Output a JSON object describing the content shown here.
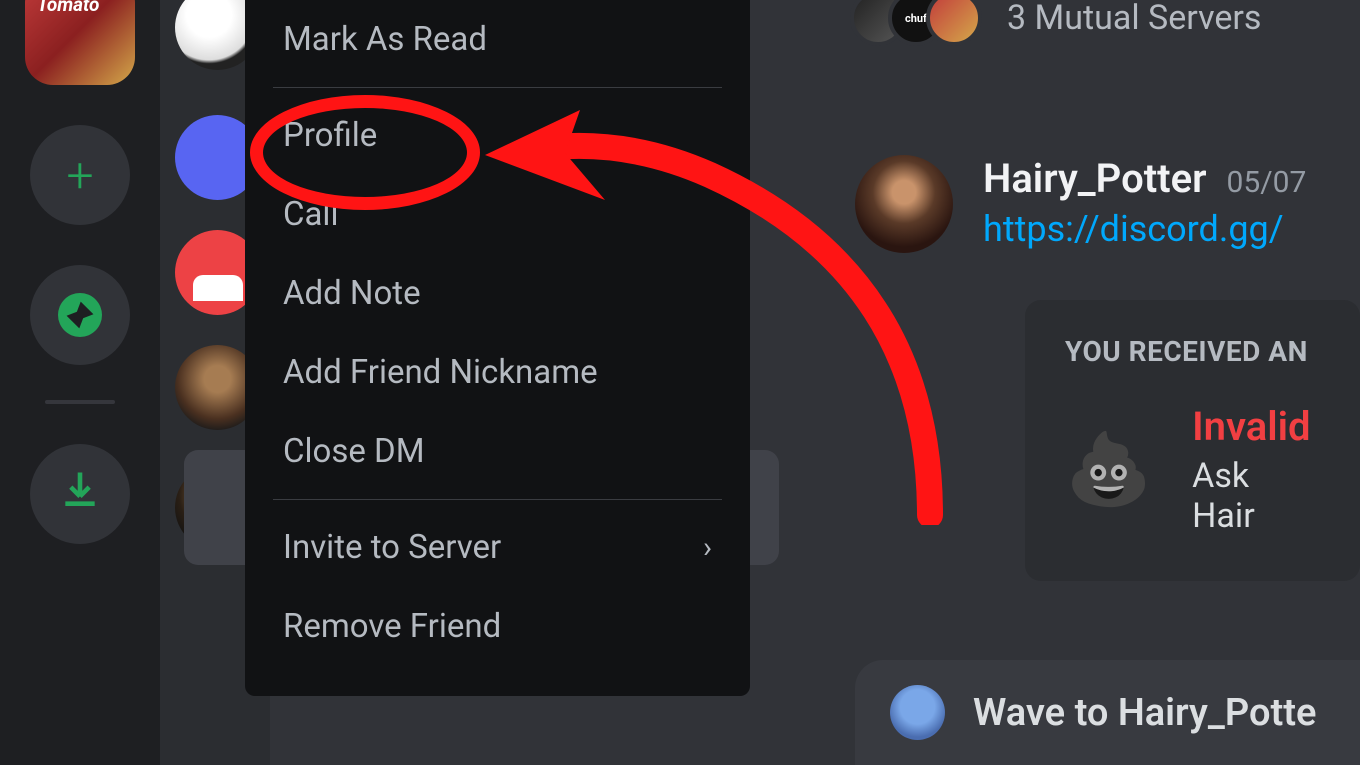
{
  "serverRail": {
    "topServerName": "Tomato"
  },
  "contextMenu": {
    "markAsRead": "Mark As Read",
    "profile": "Profile",
    "call": "Call",
    "addNote": "Add Note",
    "addFriendNickname": "Add Friend Nickname",
    "closeDm": "Close DM",
    "inviteToServer": "Invite to Server",
    "removeFriend": "Remove Friend"
  },
  "chat": {
    "mutualServersText": "3 Mutual Servers",
    "mutualBadge": "chuf",
    "message": {
      "username": "Hairy_Potter",
      "timestamp": "05/07",
      "link": "https://discord.gg/"
    },
    "inviteCard": {
      "title": "YOU RECEIVED AN",
      "invalidLabel": "Invalid",
      "subText": "Ask Hair"
    },
    "waveBar": "Wave to Hairy_Potte"
  },
  "annotation": {
    "circleColor": "#ff1414",
    "arrowColor": "#ff1414"
  }
}
